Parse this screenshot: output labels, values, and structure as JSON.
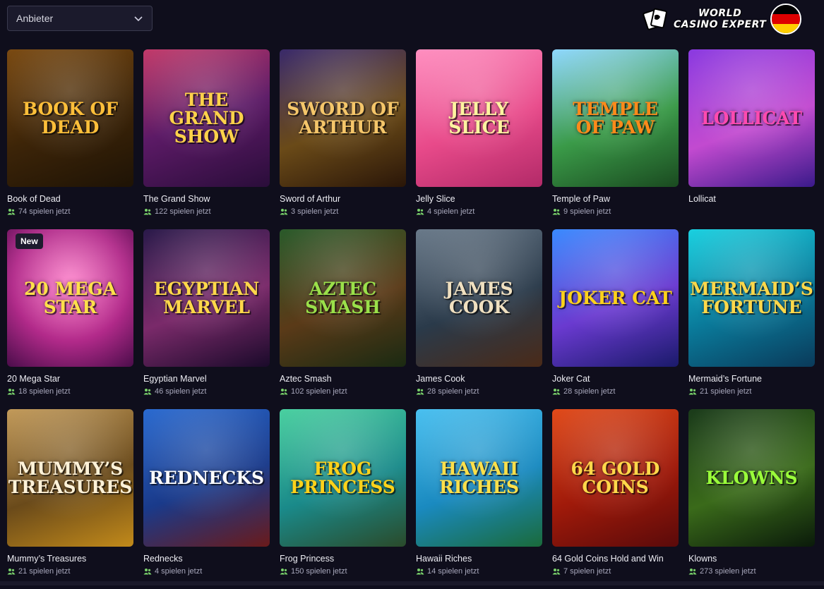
{
  "filter": {
    "label": "Anbieter"
  },
  "brand": {
    "line1": "WORLD",
    "line2": "CASINO EXPERT"
  },
  "colors": {
    "background": "#0f0e1c",
    "accent_green": "#7ad36b"
  },
  "players_suffix": "spielen jetzt",
  "games": [
    {
      "name": "Book of Dead",
      "art": "Book of Dead",
      "players": "74 spielen jetzt",
      "bg": "linear-gradient(160deg,#7a4a12,#3c2408 55%,#1e1305)",
      "fg": "#ffbf3a"
    },
    {
      "name": "The Grand Show",
      "art": "The Grand Show",
      "players": "122 spielen jetzt",
      "bg": "linear-gradient(160deg,#c23a6a,#5c1a66 50%,#2a0d3a)",
      "fg": "#ffd24a"
    },
    {
      "name": "Sword of Arthur",
      "art": "Sword of Arthur",
      "players": "3 spielen jetzt",
      "bg": "linear-gradient(160deg,#3a2a6a,#6a4a18 55%,#2a1608)",
      "fg": "#f5c66a"
    },
    {
      "name": "Jelly Slice",
      "art": "Jelly Slice",
      "players": "4 spielen jetzt",
      "bg": "linear-gradient(160deg,#ff8fc0,#e84a8a 55%,#b22a68)",
      "fg": "#fff4a0"
    },
    {
      "name": "Temple of Paw",
      "art": "Temple of Paw",
      "players": "9 spielen jetzt",
      "bg": "linear-gradient(160deg,#8fd8ff,#3a9a48 55%,#1a4a20)",
      "fg": "#ff8a1a"
    },
    {
      "name": "Lollicat",
      "art": "Lollicat",
      "players": "",
      "bg": "linear-gradient(160deg,#8a3ae0,#c24ad0 55%,#3a1a8a)",
      "fg": "#ff4ab0"
    },
    {
      "name": "20 Mega Star",
      "art": "20 Mega Star",
      "players": "18 spielen jetzt",
      "bg": "radial-gradient(circle at 50% 40%,#ff7ac8,#b22a8a 55%,#4a0d4a)",
      "fg": "#ffe04a",
      "badge": "New"
    },
    {
      "name": "Egyptian Marvel",
      "art": "Egyptian Marvel",
      "players": "46 spielen jetzt",
      "bg": "linear-gradient(160deg,#2a1a4a,#7a2a6a 55%,#1a0a2a)",
      "fg": "#ffd84a"
    },
    {
      "name": "Aztec Smash",
      "art": "Aztec Smash",
      "players": "102 spielen jetzt",
      "bg": "linear-gradient(160deg,#2a5a2a,#5a3a18 55%,#1a2a12)",
      "fg": "#9ae04a"
    },
    {
      "name": "James Cook",
      "art": "James Cook",
      "players": "28 spielen jetzt",
      "bg": "linear-gradient(160deg,#6a7a8a,#2a3a4a 55%,#4a2a18)",
      "fg": "#f0e0c0"
    },
    {
      "name": "Joker Cat",
      "art": "Joker Cat",
      "players": "28 spielen jetzt",
      "bg": "linear-gradient(160deg,#3a8aff,#6a3ad0 55%,#1a1a6a)",
      "fg": "#ffd21a"
    },
    {
      "name": "Mermaid’s Fortune",
      "art": "Mermaid’s Fortune",
      "players": "21 spielen jetzt",
      "bg": "linear-gradient(160deg,#1ad0e0,#0a7a9a 55%,#0a3a5a)",
      "fg": "#ffd84a"
    },
    {
      "name": "Mummy’s Treasures",
      "art": "Mummy’s Treasures",
      "players": "21 spielen jetzt",
      "bg": "linear-gradient(160deg,#c29a5a,#6a4a1a 55%,#c28a1a)",
      "fg": "#fff2d8"
    },
    {
      "name": "Rednecks",
      "art": "Rednecks",
      "players": "4 spielen jetzt",
      "bg": "linear-gradient(160deg,#2a6ad0,#1a3a8a 55%,#6a1a1a)",
      "fg": "#ffffff"
    },
    {
      "name": "Frog Princess",
      "art": "Frog Princess",
      "players": "150 spielen jetzt",
      "bg": "linear-gradient(160deg,#4ad0a0,#1a8a8a 55%,#2a4a2a)",
      "fg": "#ffd21a"
    },
    {
      "name": "Hawaii Riches",
      "art": "Hawaii Riches",
      "players": "14 spielen jetzt",
      "bg": "linear-gradient(160deg,#4ac0f0,#1a8ac0 55%,#1a6a3a)",
      "fg": "#ffe04a"
    },
    {
      "name": "64 Gold Coins Hold and Win",
      "art": "64 Gold Coins",
      "players": "7 spielen jetzt",
      "bg": "linear-gradient(160deg,#e04a1a,#a01a0a 55%,#5a0a0a)",
      "fg": "#ffd84a"
    },
    {
      "name": "Klowns",
      "art": "Klowns",
      "players": "273 spielen jetzt",
      "bg": "linear-gradient(160deg,#1a3a1a,#3a6a1a 55%,#0a1a0a)",
      "fg": "#9aff3a"
    }
  ]
}
